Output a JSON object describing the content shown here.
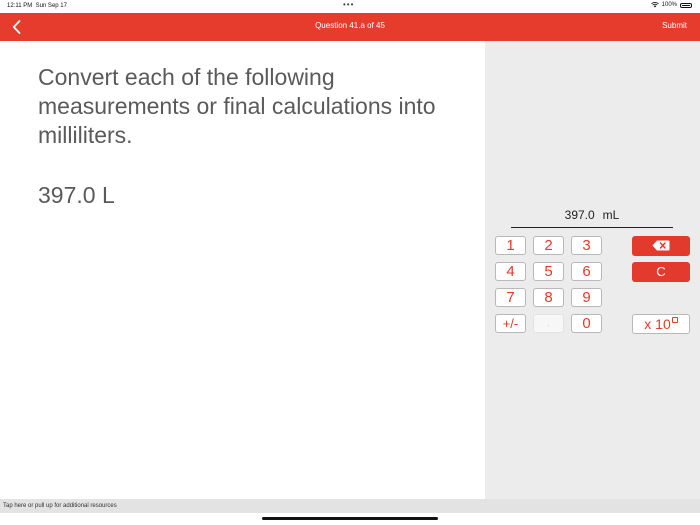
{
  "status_bar": {
    "time": "12:11 PM",
    "date": "Sun Sep 17",
    "dots": "•••",
    "battery": "100%",
    "icons": [
      "wifi-icon",
      "battery-icon"
    ]
  },
  "header": {
    "back_icon": "chevron-left-icon",
    "title": "Question 41.a of 45",
    "submit_label": "Submit",
    "color": "#e63c2e"
  },
  "question": {
    "prompt": "Convert each of the following measurements or final calculations into milliliters.",
    "value": "397.0 L"
  },
  "answer": {
    "value": "397.0",
    "unit": "mL"
  },
  "keypad": {
    "keys": {
      "k1": "1",
      "k2": "2",
      "k3": "3",
      "k4": "4",
      "k5": "5",
      "k6": "6",
      "k7": "7",
      "k8": "8",
      "k9": "9",
      "sign": "+/-",
      "dot": ".",
      "k0": "0"
    },
    "backspace_icon": "backspace-icon",
    "clear_label": "C",
    "exponent_label": "x 10",
    "accent_color": "#e23a2c"
  },
  "footer": {
    "resources_text": "Tap here or pull up for additional resources"
  }
}
